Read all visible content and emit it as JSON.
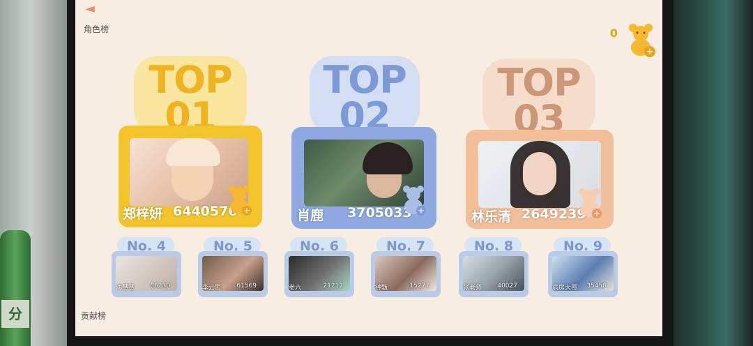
{
  "header": {
    "back_icon": "back-arrow-icon",
    "role_rank_label": "角色榜",
    "coin_count": "0"
  },
  "footer": {
    "contrib_label": "贡献榜"
  },
  "top3": [
    {
      "rank_top": "TOP",
      "rank_num": "01",
      "name": "郑梓妍",
      "score": "6440576",
      "color": "#f1c232"
    },
    {
      "rank_top": "TOP",
      "rank_num": "02",
      "name": "肖鹿",
      "score": "3705033",
      "color": "#7d9ad8"
    },
    {
      "rank_top": "TOP",
      "rank_num": "03",
      "name": "林乐清",
      "score": "2649239",
      "color": "#f0b58e"
    }
  ],
  "others": [
    {
      "label": "No. 4",
      "name": "沈慧慧",
      "score": "86230"
    },
    {
      "label": "No. 5",
      "name": "李云思",
      "score": "61569"
    },
    {
      "label": "No. 6",
      "name": "老六",
      "score": "21217"
    },
    {
      "label": "No. 7",
      "name": "钟甄",
      "score": "15277"
    },
    {
      "label": "No. 8",
      "name": "张老师",
      "score": "40027"
    },
    {
      "label": "No. 9",
      "name": "病房大哥",
      "score": "35458"
    }
  ],
  "colors": {
    "gold": "#f1c232",
    "blue": "#7d9ad8",
    "peach": "#f0b58e",
    "bg": "#f7ede2"
  }
}
